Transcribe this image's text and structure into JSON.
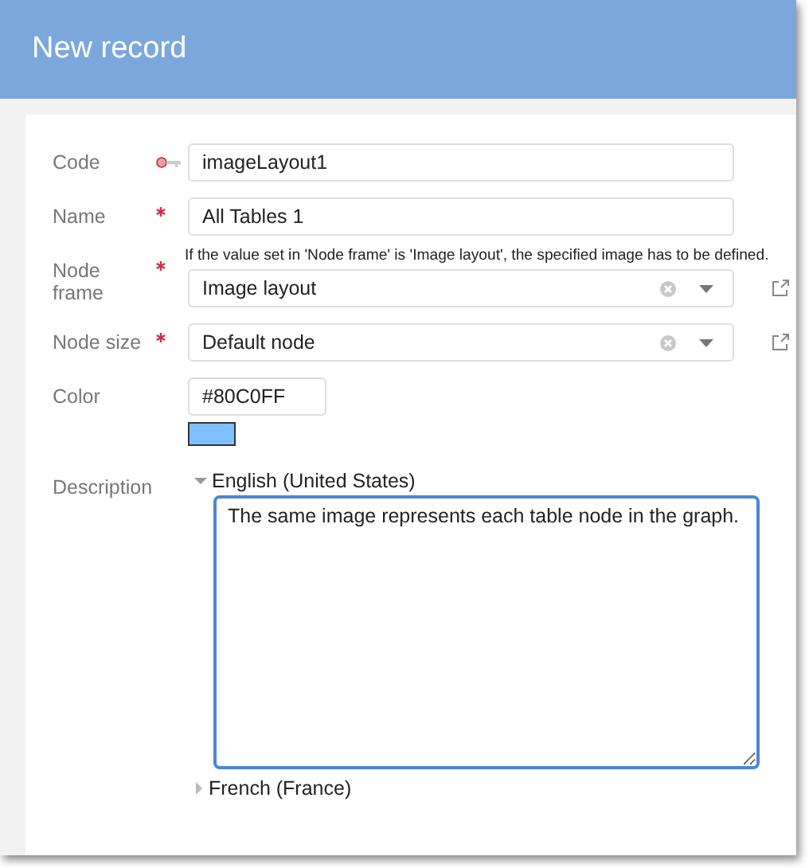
{
  "window": {
    "title": "New record"
  },
  "fields": [
    {
      "kind": "text",
      "label": "Code",
      "key": true,
      "value": "imageLayout1"
    },
    {
      "kind": "text",
      "label": "Name",
      "required": true,
      "value": "All Tables 1"
    },
    {
      "kind": "select",
      "label": "Node frame",
      "required": true,
      "hint": "If the value set in 'Node frame' is 'Image layout', the specified image has to be defined.",
      "value": "Image layout"
    },
    {
      "kind": "select",
      "label": "Node size",
      "required": true,
      "value": "Default node"
    },
    {
      "kind": "color",
      "label": "Color",
      "value": "#80C0FF",
      "color": "#80c0ff"
    },
    {
      "kind": "translations",
      "label": "Description",
      "languages": [
        {
          "name": "English (United States)",
          "expanded": true,
          "text": "The same image represents each table node in the graph."
        },
        {
          "name": "French (France)",
          "expanded": false
        }
      ]
    }
  ]
}
